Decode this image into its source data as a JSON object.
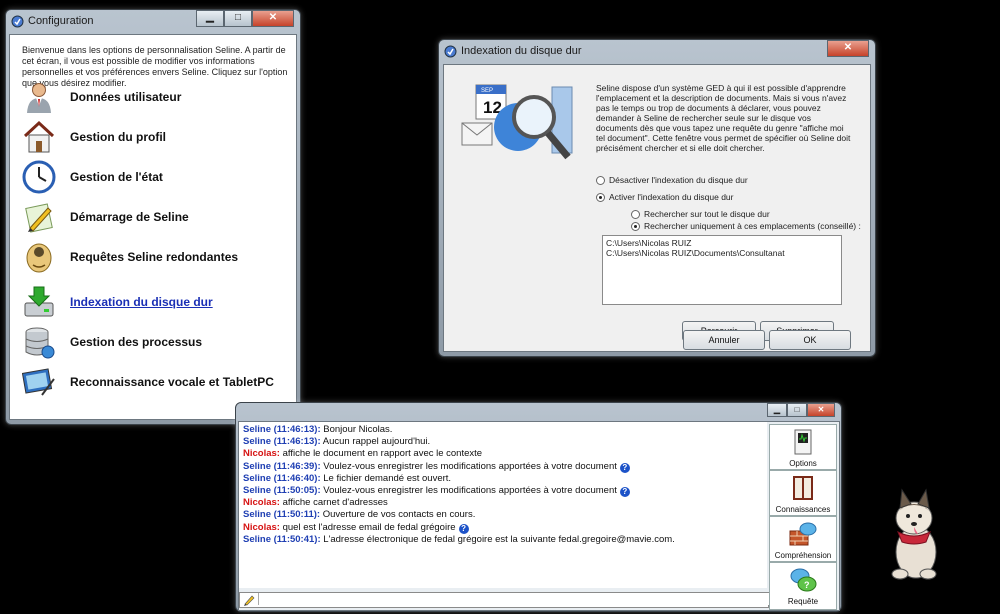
{
  "config": {
    "title": "Configuration",
    "intro": "Bienvenue dans les options de personnalisation Seline. A partir de cet écran, il vous est possible de modifier vos informations personnelles et vos préférences envers Seline. Cliquez sur l'option que vous désirez modifier.",
    "items": [
      {
        "label": "Données utilisateur",
        "icon": "user-icon"
      },
      {
        "label": "Gestion du profil",
        "icon": "house-icon"
      },
      {
        "label": "Gestion de l'état",
        "icon": "clock-icon"
      },
      {
        "label": "Démarrage de Seline",
        "icon": "pencil-icon"
      },
      {
        "label": "Requêtes Seline redondantes",
        "icon": "face-icon"
      },
      {
        "label": "Indexation du disque dur",
        "icon": "disk-download-icon",
        "active": true
      },
      {
        "label": "Gestion des processus",
        "icon": "database-icon"
      },
      {
        "label": "Reconnaissance vocale et TabletPC",
        "icon": "tablet-icon"
      }
    ]
  },
  "indexation": {
    "title": "Indexation du disque dur",
    "description": "Seline dispose d'un système GED à qui il est possible d'apprendre l'emplacement et la description de documents. Mais si vous n'avez pas le temps ou trop de documents à déclarer, vous pouvez demander à Seline de rechercher seule sur le disque vos documents dès que vous tapez une requête du genre \"affiche moi tel document\". Cette fenêtre vous permet de spécifier où Seline doit précisément chercher et si elle doit chercher.",
    "calendar_month": "SEP",
    "calendar_day": "12",
    "options": {
      "disable": "Désactiver l'indexation du disque dur",
      "enable": "Activer l'indexation du disque dur",
      "search_all": "Rechercher sur tout le disque dur",
      "search_locations": "Rechercher uniquement à ces emplacements (conseillé) :"
    },
    "selected_option": "enable",
    "selected_scope": "search_locations",
    "paths": [
      "C:\\Users\\Nicolas RUIZ",
      "C:\\Users\\Nicolas RUIZ\\Documents\\Consultanat"
    ],
    "buttons": {
      "browse": "Parcourir",
      "delete": "Supprimer",
      "cancel": "Annuler",
      "ok": "OK"
    }
  },
  "chat": {
    "messages": [
      {
        "who": "Seline (11:46:13):",
        "speaker": "seline",
        "text": "Bonjour Nicolas.",
        "help": false
      },
      {
        "who": "Seline (11:46:13):",
        "speaker": "seline",
        "text": "Aucun rappel aujourd'hui.",
        "help": false
      },
      {
        "who": "Nicolas:",
        "speaker": "nicolas",
        "text": "affiche le document en rapport avec le contexte",
        "help": false
      },
      {
        "who": "Seline (11:46:39):",
        "speaker": "seline",
        "text": "Voulez-vous enregistrer les modifications apportées à votre document",
        "help": true
      },
      {
        "who": "Seline (11:46:40):",
        "speaker": "seline",
        "text": "Le fichier demandé est ouvert.",
        "help": false
      },
      {
        "who": "Seline (11:50:05):",
        "speaker": "seline",
        "text": "Voulez-vous enregistrer les modifications apportées à votre document",
        "help": true
      },
      {
        "who": "Nicolas:",
        "speaker": "nicolas",
        "text": "affiche carnet d'adresses",
        "help": false
      },
      {
        "who": "Seline (11:50:11):",
        "speaker": "seline",
        "text": "Ouverture de vos contacts en cours.",
        "help": false
      },
      {
        "who": "Nicolas:",
        "speaker": "nicolas",
        "text": "quel est l'adresse email de fedal grégoire",
        "help": true
      },
      {
        "who": "Seline (11:50:41):",
        "speaker": "seline",
        "text": "L'adresse électronique de fedal grégoire est la suivante fedal.gregoire@mavie.com.",
        "help": false
      }
    ],
    "side": [
      {
        "label": "Options",
        "icon": "options-icon"
      },
      {
        "label": "Connaissances",
        "icon": "book-icon"
      },
      {
        "label": "Compréhension",
        "icon": "wall-bubble-icon"
      },
      {
        "label": "Requête",
        "icon": "chat-bubbles-icon"
      }
    ],
    "input_value": ""
  },
  "colors": {
    "seline": "#1f3fb3",
    "nicolas": "#d61313",
    "link": "#1a2fb5"
  }
}
